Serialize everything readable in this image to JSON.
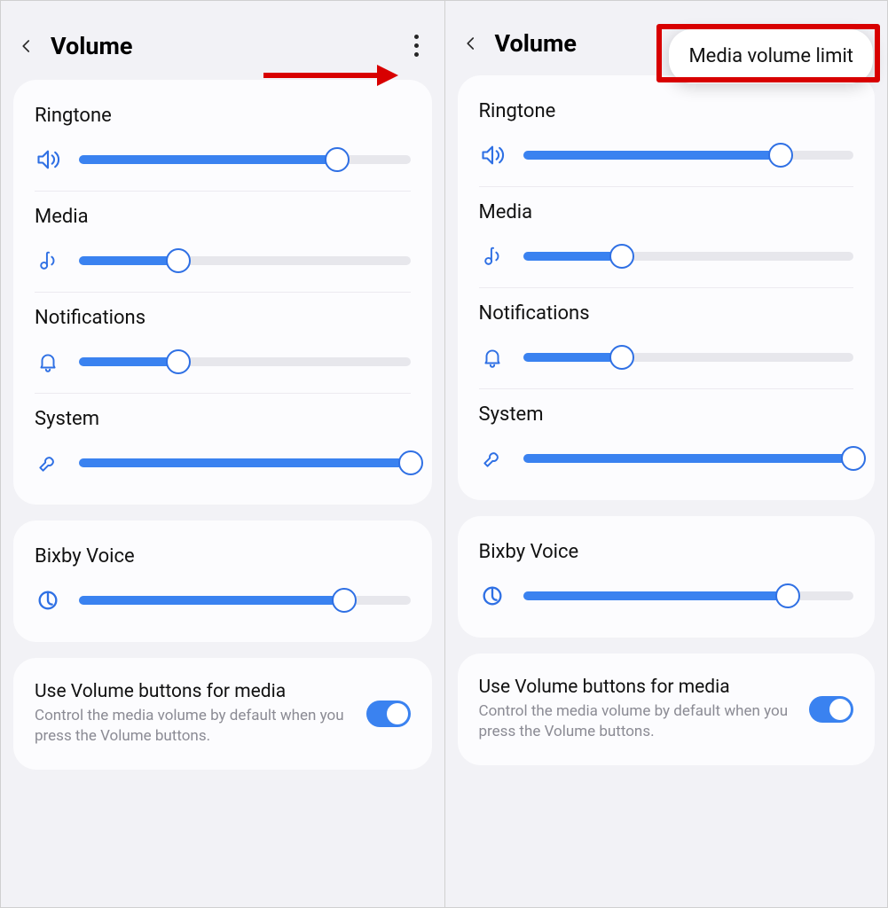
{
  "colors": {
    "accent": "#3a82f0",
    "highlight": "#d80000"
  },
  "left": {
    "title": "Volume",
    "show_more_menu": true,
    "show_arrow": true,
    "sliders": [
      {
        "label": "Ringtone",
        "icon": "speaker-icon",
        "value": 78
      },
      {
        "label": "Media",
        "icon": "music-icon",
        "value": 30
      },
      {
        "label": "Notifications",
        "icon": "bell-icon",
        "value": 30
      },
      {
        "label": "System",
        "icon": "wrench-icon",
        "value": 100
      }
    ],
    "bixby": {
      "label": "Bixby Voice",
      "icon": "bixby-icon",
      "value": 80
    },
    "media_buttons": {
      "title": "Use Volume buttons for media",
      "sub": "Control the media volume by default when you press the Volume buttons.",
      "enabled": true
    }
  },
  "right": {
    "title": "Volume",
    "popup_label": "Media volume limit",
    "sliders": [
      {
        "label": "Ringtone",
        "icon": "speaker-icon",
        "value": 78
      },
      {
        "label": "Media",
        "icon": "music-icon",
        "value": 30
      },
      {
        "label": "Notifications",
        "icon": "bell-icon",
        "value": 30
      },
      {
        "label": "System",
        "icon": "wrench-icon",
        "value": 100
      }
    ],
    "bixby": {
      "label": "Bixby Voice",
      "icon": "bixby-icon",
      "value": 80
    },
    "media_buttons": {
      "title": "Use Volume buttons for media",
      "sub": "Control the media volume by default when you press the Volume buttons.",
      "enabled": true
    }
  }
}
